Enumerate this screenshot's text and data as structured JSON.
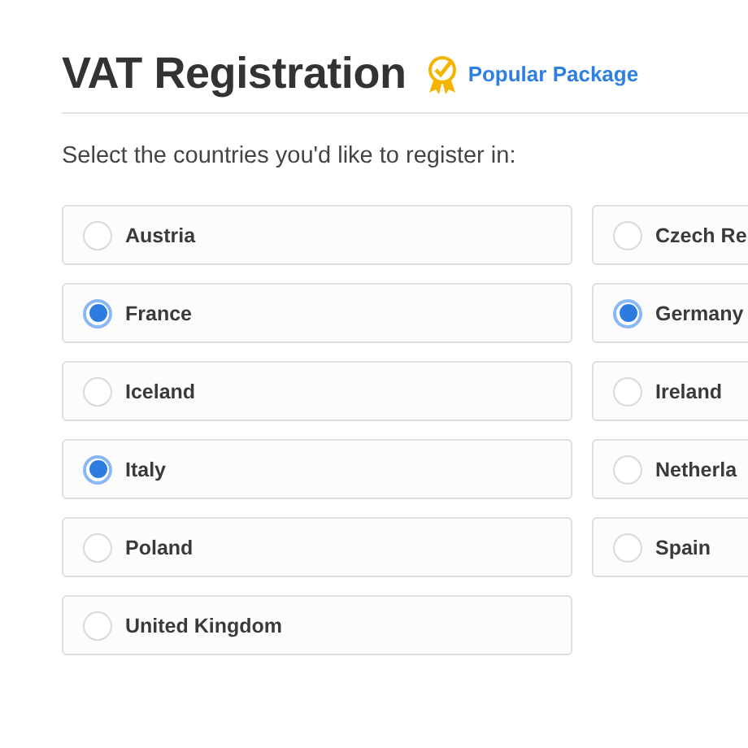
{
  "header": {
    "title": "VAT Registration",
    "badge": "Popular Package"
  },
  "prompt": "Select the countries you'd like to register in:",
  "countries": [
    {
      "label": "Austria",
      "selected": false
    },
    {
      "label": "Czech Re",
      "selected": false
    },
    {
      "label": "France",
      "selected": true
    },
    {
      "label": "Germany",
      "selected": true
    },
    {
      "label": "Iceland",
      "selected": false
    },
    {
      "label": "Ireland",
      "selected": false
    },
    {
      "label": "Italy",
      "selected": true
    },
    {
      "label": "Netherla",
      "selected": false
    },
    {
      "label": "Poland",
      "selected": false
    },
    {
      "label": "Spain",
      "selected": false
    },
    {
      "label": "United Kingdom",
      "selected": false
    }
  ]
}
